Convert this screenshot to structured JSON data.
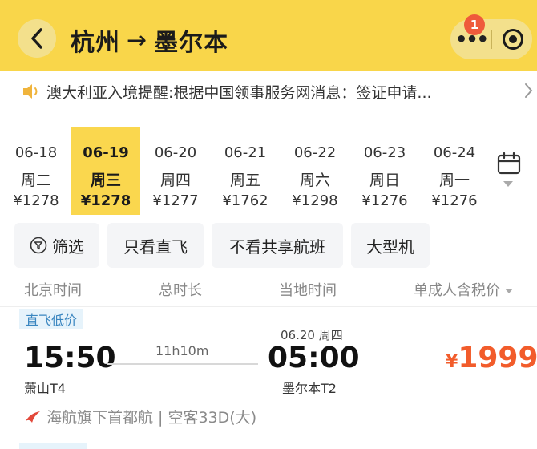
{
  "header": {
    "origin": "杭州",
    "arrow": "→",
    "destination": "墨尔本",
    "notification_count": "1",
    "more_label": "•••"
  },
  "notice": {
    "text": "澳大利亚入境提醒:根据中国领事服务网消息：签证申请..."
  },
  "dates": [
    {
      "date": "06-18",
      "weekday": "周二",
      "price": "¥1278"
    },
    {
      "date": "06-19",
      "weekday": "周三",
      "price": "¥1278"
    },
    {
      "date": "06-20",
      "weekday": "周四",
      "price": "¥1277"
    },
    {
      "date": "06-21",
      "weekday": "周五",
      "price": "¥1762"
    },
    {
      "date": "06-22",
      "weekday": "周六",
      "price": "¥1298"
    },
    {
      "date": "06-23",
      "weekday": "周日",
      "price": "¥1276"
    },
    {
      "date": "06-24",
      "weekday": "周一",
      "price": "¥1276"
    }
  ],
  "selected_date_index": 1,
  "filters": {
    "filter": "筛选",
    "direct_only": "只看直飞",
    "no_shared": "不看共享航班",
    "large_aircraft": "大型机"
  },
  "columns": {
    "beijing_time": "北京时间",
    "duration": "总时长",
    "local_time": "当地时间",
    "price_sort": "单成人含税价"
  },
  "flight": {
    "tag": "直飞低价",
    "dep_time": "15:50",
    "dep_airport": "萧山T4",
    "duration": "11h10m",
    "arr_date": "06.20 周四",
    "arr_time": "05:00",
    "arr_airport": "墨尔本T2",
    "currency": "¥",
    "price": "1999",
    "airline": "海航旗下首都航 | 空客33D(大)"
  },
  "colors": {
    "brand_yellow": "#f9d64a",
    "price_orange": "#f25c2b",
    "tag_blue": "#3a86c0"
  }
}
